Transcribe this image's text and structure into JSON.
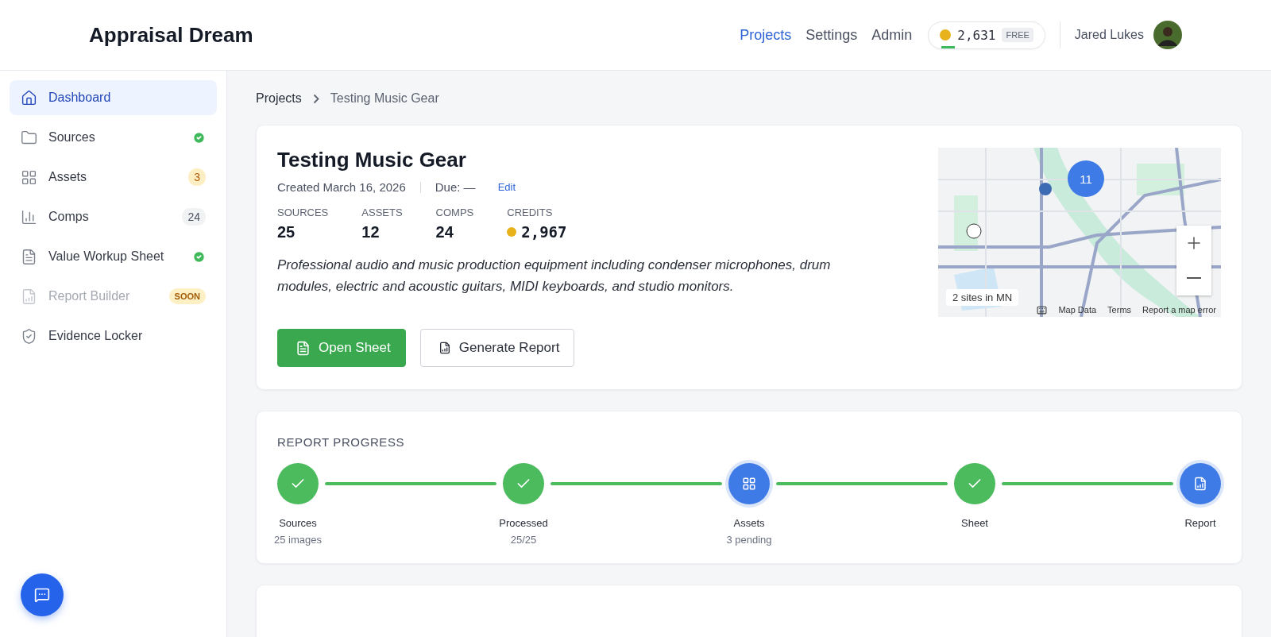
{
  "header": {
    "logo": "Appraisal Dream",
    "nav": [
      {
        "label": "Projects",
        "selected": true
      },
      {
        "label": "Settings",
        "selected": false
      },
      {
        "label": "Admin",
        "selected": false
      }
    ],
    "credits": {
      "amount": "2,631",
      "plan": "FREE",
      "level": 0.15
    },
    "user": {
      "name": "Jared Lukes"
    }
  },
  "sidebar": {
    "items": [
      {
        "label": "Dashboard",
        "selected": true,
        "disabled": false
      },
      {
        "label": "Sources",
        "selected": false,
        "disabled": false,
        "badge": {
          "kind": "check"
        }
      },
      {
        "label": "Assets",
        "selected": false,
        "disabled": false,
        "badge": {
          "kind": "warning",
          "text": "3"
        }
      },
      {
        "label": "Comps",
        "selected": false,
        "disabled": false,
        "badge": {
          "kind": "count",
          "text": "24"
        }
      },
      {
        "label": "Value Workup Sheet",
        "selected": false,
        "disabled": false,
        "badge": {
          "kind": "check"
        }
      },
      {
        "label": "Report Builder",
        "selected": false,
        "disabled": true,
        "badge": {
          "kind": "soon",
          "text": "SOON"
        }
      },
      {
        "label": "Evidence Locker",
        "selected": false,
        "disabled": false
      }
    ]
  },
  "breadcrumb": [
    "Projects",
    "Testing Music Gear"
  ],
  "project": {
    "title": "Testing Music Gear",
    "created": "Created March 16, 2026",
    "due": "Due: —",
    "edit": "Edit",
    "stats": [
      {
        "label": "SOURCES",
        "value": "25"
      },
      {
        "label": "ASSETS",
        "value": "12"
      },
      {
        "label": "COMPS",
        "value": "24"
      },
      {
        "label": "CREDITS",
        "value": "2,967",
        "coin": true
      }
    ],
    "description": "Professional audio and music production equipment including condenser microphones, drum modules, electric and acoustic guitars, MIDI keyboards, and studio monitors.",
    "buttons": [
      {
        "label": "Open Sheet",
        "kind": "primary"
      },
      {
        "label": "Generate Report",
        "kind": "secondary"
      }
    ],
    "map": {
      "cluster": "11",
      "caption": "2 sites in MN",
      "links": [
        "Map Data",
        "Terms",
        "Report a map error"
      ]
    }
  },
  "progress": {
    "title": "REPORT PROGRESS",
    "steps": [
      {
        "label": "Sources",
        "detail": "25 images",
        "done": true
      },
      {
        "label": "Processed",
        "detail": "25/25",
        "done": true
      },
      {
        "label": "Assets",
        "detail": "3 pending",
        "done": false
      },
      {
        "label": "Sheet",
        "done": true
      },
      {
        "label": "Report",
        "done": false
      }
    ]
  }
}
